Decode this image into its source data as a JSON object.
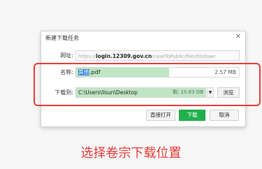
{
  "dialog": {
    "title": "新建下载任务",
    "close_icon": "close-icon",
    "url_label": "网址:",
    "url_prefix": "https://",
    "url_domain": "login.12309.gov.cn",
    "url_path": "/caseToPublic/fileUtil/dowr",
    "name_label": "名称:",
    "name_selected": "其他",
    "name_rest": ".pdf",
    "file_size": "2.57 MB",
    "path_label": "下载到:",
    "path_value": "C:\\Users\\llsun\\Desktop",
    "free_space": "剩: 10.83 GB",
    "dropdown_icon": "chevron-down-icon",
    "browse_label": "浏览",
    "open_label": "直接打开",
    "download_label": "下载",
    "cancel_label": "取消"
  },
  "caption": "选择卷宗下载位置",
  "colors": {
    "highlight": "#e53935",
    "download_button": "#21b14c",
    "field_fill": "#bfe6c3",
    "selection": "#2f7fd6"
  }
}
